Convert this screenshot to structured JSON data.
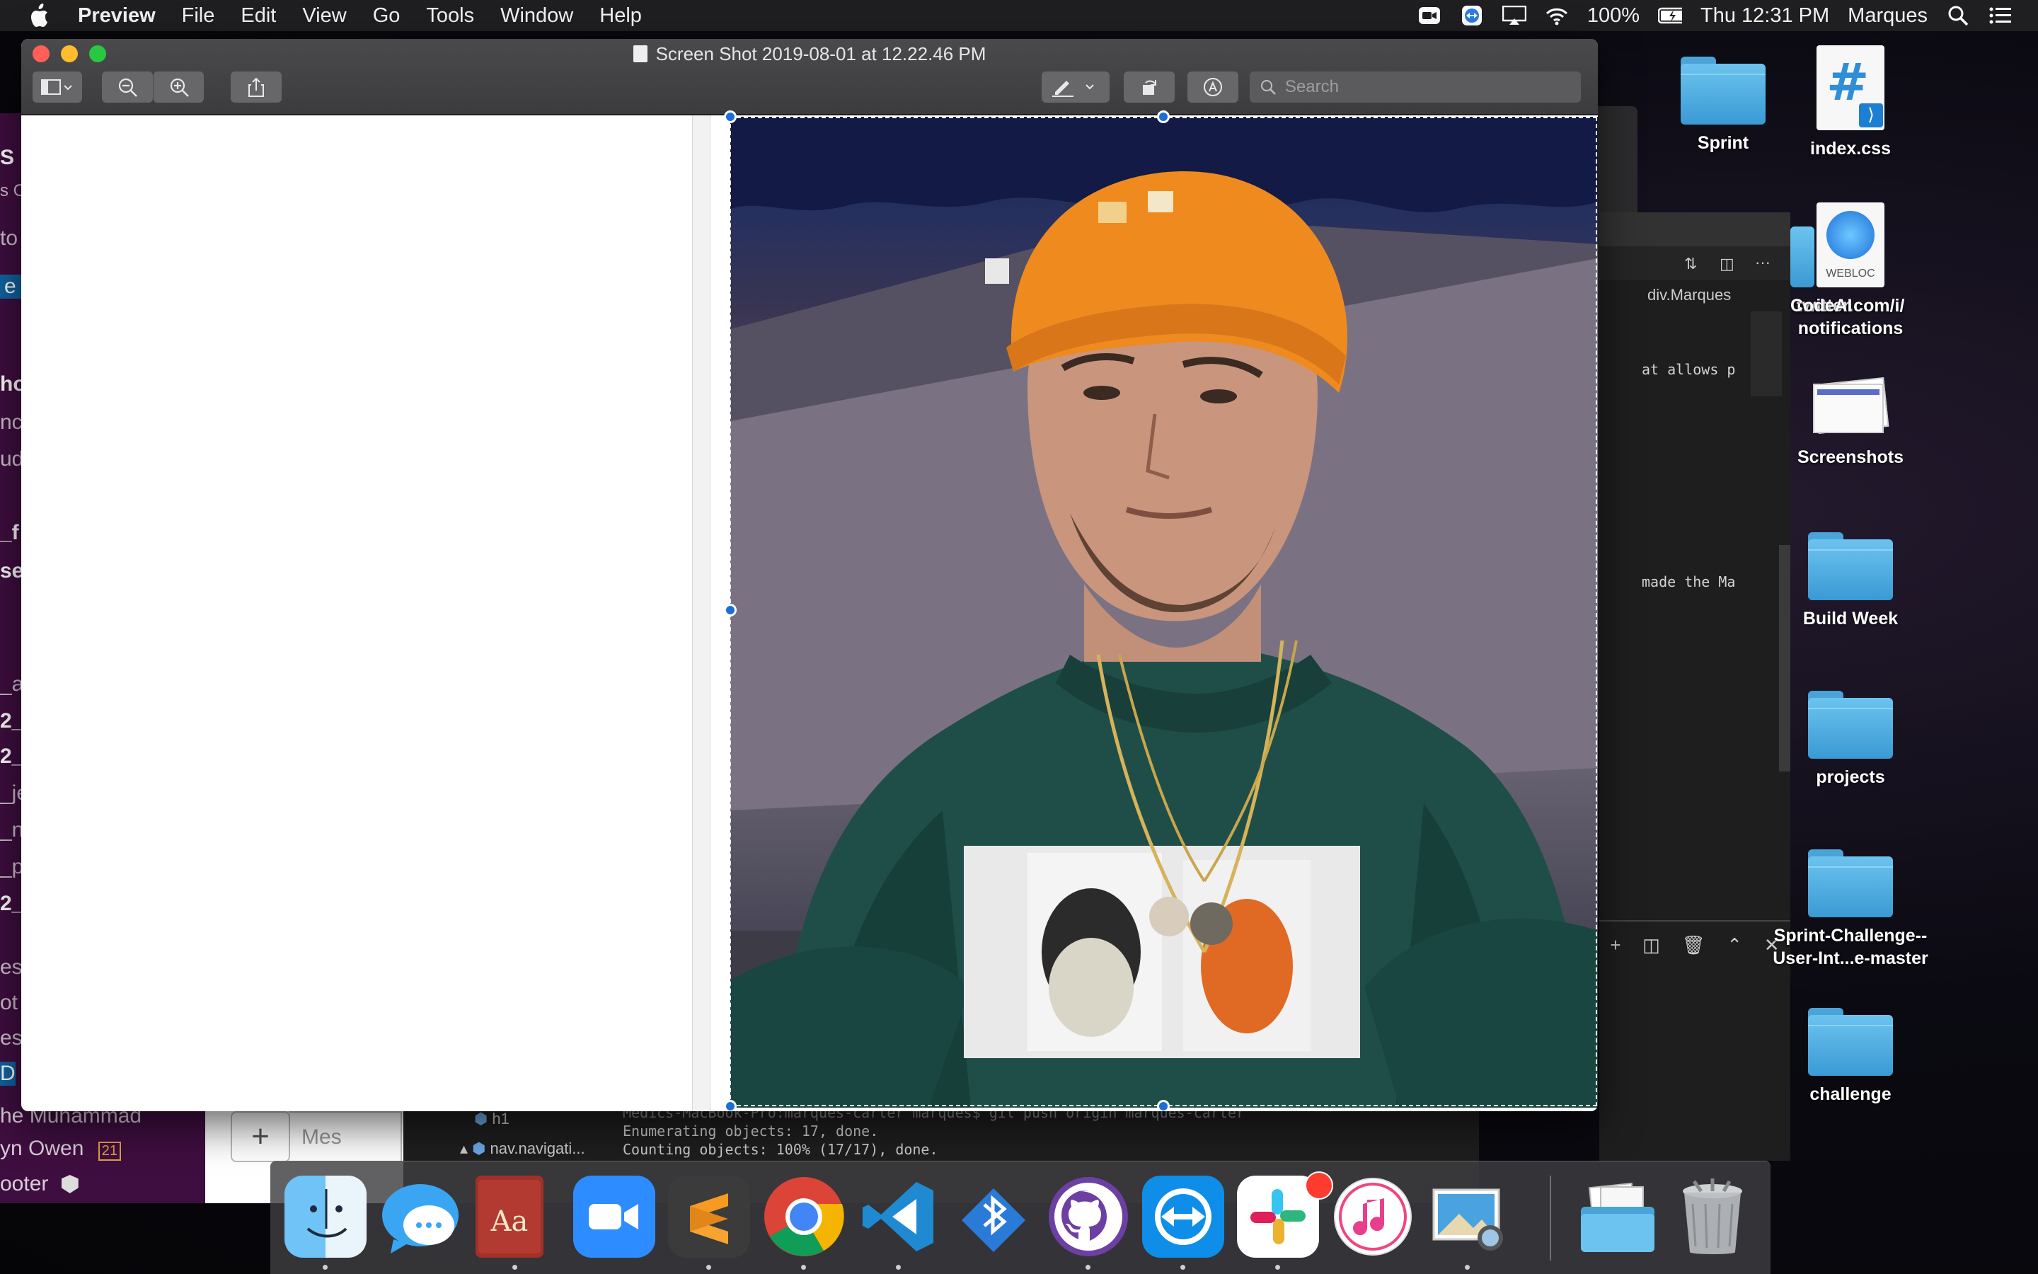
{
  "menubar": {
    "app_name": "Preview",
    "menus": [
      "File",
      "Edit",
      "View",
      "Go",
      "Tools",
      "Window",
      "Help"
    ],
    "battery": "100%",
    "clock": "Thu 12:31 PM",
    "user": "Marques",
    "status_icons": [
      "zoom-icon",
      "teamviewer-icon",
      "airplay-icon",
      "wifi-icon",
      "battery-charging-icon",
      "spotlight-icon",
      "notification-center-icon"
    ]
  },
  "preview": {
    "title": "Screen Shot 2019-08-01 at 12.22.46 PM",
    "search_placeholder": "Search",
    "toolbar": [
      "sidebar-toggle-icon",
      "zoom-out-icon",
      "zoom-in-icon",
      "share-icon",
      "markup-pen-icon",
      "rotate-icon",
      "markup-toolbar-icon"
    ]
  },
  "background": {
    "slack_left_fragments": [
      "S",
      "s C",
      "to",
      "e I",
      "ho",
      "nc",
      "ud",
      "_f",
      "se",
      "_a",
      "2_c",
      "2_h",
      "_je",
      "_n",
      "_p",
      "2_s",
      "es",
      "ot",
      "es",
      "D"
    ],
    "slack_members": [
      "he Muhammad",
      "yn Owen",
      "ooter"
    ],
    "slack_member_badge": "21",
    "compose_placeholder": "Mes",
    "vscode_breadcrumb": "div.Marques",
    "code_line_1": "at allows p",
    "code_line_2": "made the Ma",
    "outline_h1": "h1",
    "outline_nav": "nav.navigati...",
    "terminal_lines": [
      "Medics-MacBook-Pro:marques-carter marques$ git push origin marques-carter",
      "Enumerating objects: 17, done.",
      "Counting objects: 100% (17/17), done."
    ],
    "partial_folder_label": "CodeAI"
  },
  "desktop": {
    "items": [
      {
        "label": "Sprint",
        "kind": "folder"
      },
      {
        "label": "index.css",
        "kind": "css-file"
      },
      {
        "label": "twitter.com/i/ notifications",
        "kind": "webloc",
        "tag": "WEBLOC"
      },
      {
        "label": "Screenshots",
        "kind": "screenshot-stack"
      },
      {
        "label": "Build Week",
        "kind": "folder"
      },
      {
        "label": "projects",
        "kind": "folder"
      },
      {
        "label": "Sprint-Challenge-- User-Int...e-master",
        "kind": "folder"
      },
      {
        "label": "challenge",
        "kind": "folder"
      }
    ]
  },
  "dock": {
    "apps": [
      "Finder",
      "Messages",
      "Dictionary",
      "Zoom",
      "Sublime Text",
      "Google Chrome",
      "Visual Studio Code",
      "Bluetooth File Exchange",
      "GitHub Desktop",
      "TeamViewer",
      "Slack",
      "iTunes",
      "Preview",
      "Downloads",
      "Trash"
    ]
  }
}
